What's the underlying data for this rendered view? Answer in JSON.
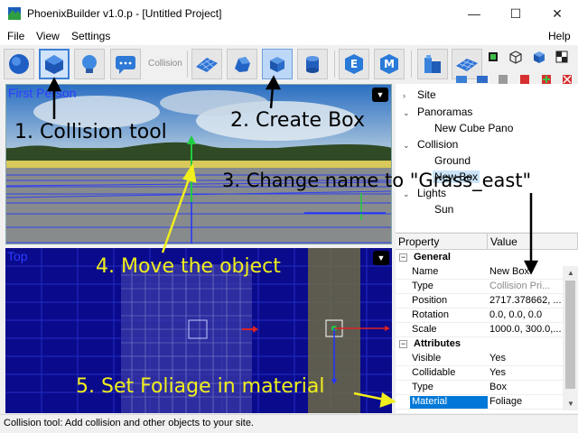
{
  "window": {
    "title": "PhoenixBuilder v1.0.p - [Untitled Project]",
    "controls": {
      "minimize": "—",
      "maximize": "☐",
      "close": "✕"
    }
  },
  "menu": {
    "items": [
      "File",
      "View",
      "Settings"
    ],
    "help": "Help"
  },
  "toolbar": {
    "collision_label": "Collision",
    "buttons": [
      "globe-icon",
      "collision-tool-icon",
      "light-bulb-icon",
      "chat-icon",
      "terrain-icon",
      "rock-icon",
      "create-box-icon",
      "cylinder-icon",
      "e-icon",
      "m-icon",
      "buildings-icon",
      "solar-panel-icon"
    ]
  },
  "views": {
    "first_person": "First Person",
    "top": "Top"
  },
  "tree": {
    "items": [
      "Site",
      "Panoramas",
      "New Cube Pano",
      "Collision",
      "Ground",
      "New Box",
      "Lights",
      "Sun"
    ]
  },
  "properties": {
    "header_property": "Property",
    "header_value": "Value",
    "general": "General",
    "rows_general": [
      {
        "name": "Name",
        "value": "New Box"
      },
      {
        "name": "Type",
        "value": "Collision Pri..."
      },
      {
        "name": "Position",
        "value": "2717.378662, ..."
      },
      {
        "name": "Rotation",
        "value": "0.0, 0.0, 0.0"
      },
      {
        "name": "Scale",
        "value": "1000.0, 300.0,..."
      }
    ],
    "attributes": "Attributes",
    "rows_attributes": [
      {
        "name": "Visible",
        "value": "Yes"
      },
      {
        "name": "Collidable",
        "value": "Yes"
      },
      {
        "name": "Type",
        "value": "Box"
      },
      {
        "name": "Material",
        "value": "Foliage"
      }
    ]
  },
  "status": "Collision tool: Add collision and other objects to your site.",
  "annotations": {
    "step1": "1. Collision tool",
    "step2": "2. Create Box",
    "step3": "3. Change name to \"Grass_east\"",
    "step4": "4. Move the object",
    "step5": "5. Set Foliage in material"
  },
  "colors": {
    "annotation_black": "#000000",
    "annotation_yellow": "#f0ee1c",
    "grid_blue": "#2233ff",
    "selection_blue": "#0078d7"
  }
}
